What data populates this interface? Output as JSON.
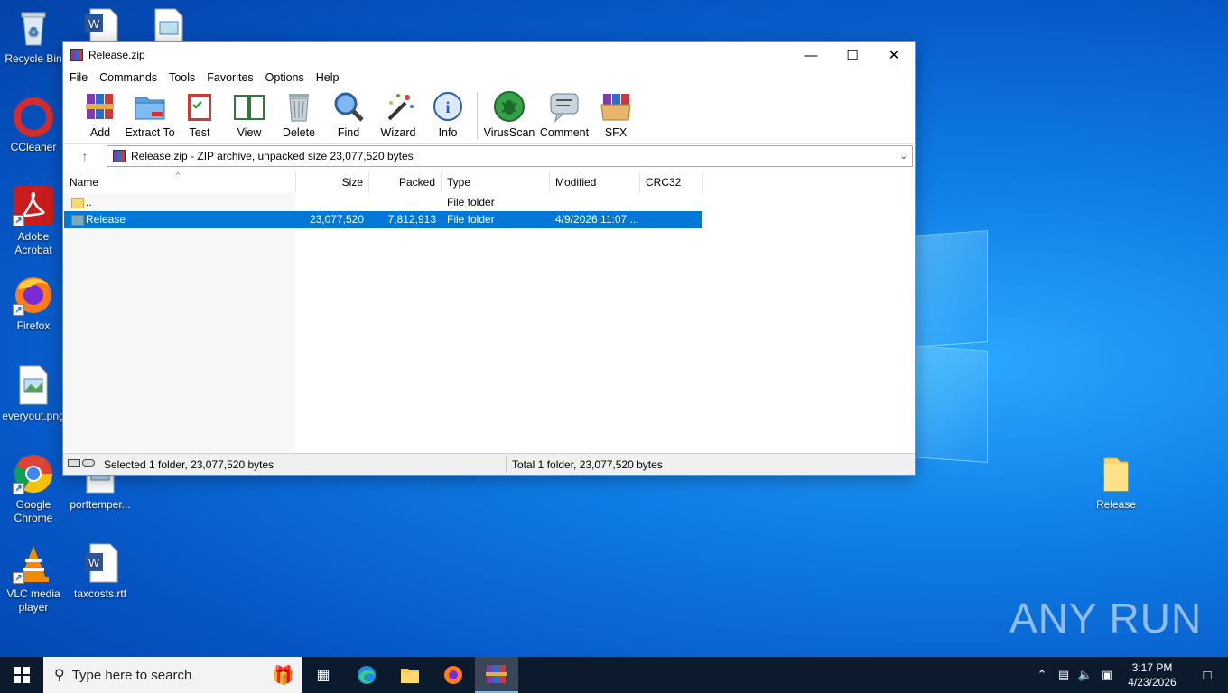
{
  "desktop": {
    "icons_left": [
      {
        "label": "Recycle Bin",
        "icon": "recycle-bin-icon"
      },
      {
        "label": "CCleaner",
        "icon": "ccleaner-icon"
      },
      {
        "label": "Adobe Acrobat",
        "icon": "acrobat-icon"
      },
      {
        "label": "Firefox",
        "icon": "firefox-icon"
      },
      {
        "label": "everyout.png",
        "icon": "image-file-icon"
      },
      {
        "label": "Google Chrome",
        "icon": "chrome-icon"
      },
      {
        "label": "VLC media player",
        "icon": "vlc-icon"
      }
    ],
    "icons_col2": [
      {
        "label": "porttemper...",
        "icon": "image-file-icon"
      },
      {
        "label": "taxcosts.rtf",
        "icon": "word-doc-icon"
      }
    ],
    "icon_right": {
      "label": "Release",
      "icon": "folder-icon"
    },
    "watermark": "ANY RUN"
  },
  "window": {
    "title": "Release.zip",
    "menu": [
      "File",
      "Commands",
      "Tools",
      "Favorites",
      "Options",
      "Help"
    ],
    "toolbar": [
      {
        "label": "Add",
        "icon": "add-archive-icon"
      },
      {
        "label": "Extract To",
        "icon": "extract-folder-icon"
      },
      {
        "label": "Test",
        "icon": "test-clipboard-icon"
      },
      {
        "label": "View",
        "icon": "view-book-icon"
      },
      {
        "label": "Delete",
        "icon": "trash-icon"
      },
      {
        "label": "Find",
        "icon": "magnifier-icon"
      },
      {
        "label": "Wizard",
        "icon": "wand-icon"
      },
      {
        "label": "Info",
        "icon": "info-icon"
      },
      {
        "label": "VirusScan",
        "icon": "virus-scan-icon"
      },
      {
        "label": "Comment",
        "icon": "comment-icon"
      },
      {
        "label": "SFX",
        "icon": "sfx-box-icon"
      }
    ],
    "address": "Release.zip - ZIP archive, unpacked size 23,077,520 bytes",
    "columns": [
      "Name",
      "Size",
      "Packed",
      "Type",
      "Modified",
      "CRC32"
    ],
    "rows": [
      {
        "name": "..",
        "size": "",
        "packed": "",
        "type": "File folder",
        "modified": "",
        "crc": ""
      },
      {
        "name": "Release",
        "size": "23,077,520",
        "packed": "7,812,913",
        "type": "File folder",
        "modified": "4/9/2026 11:07 ...",
        "crc": ""
      }
    ],
    "status_left": "Selected 1 folder, 23,077,520 bytes",
    "status_right": "Total 1 folder, 23,077,520 bytes"
  },
  "taskbar": {
    "search_placeholder": "Type here to search",
    "time": "3:17 PM",
    "date": "4/23/2026"
  },
  "colors": {
    "selection": "#0078d7",
    "taskbar": "#0c1a2e",
    "wallpaper": "#0a6fd8"
  }
}
